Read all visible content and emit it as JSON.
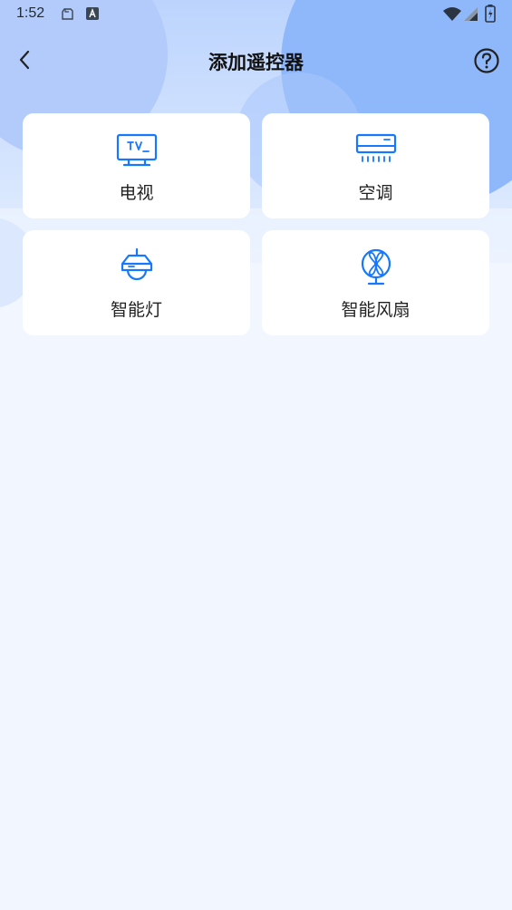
{
  "status_bar": {
    "time": "1:52"
  },
  "header": {
    "title": "添加遥控器"
  },
  "devices": [
    {
      "label": "电视",
      "icon": "tv-icon"
    },
    {
      "label": "空调",
      "icon": "air-conditioner-icon"
    },
    {
      "label": "智能灯",
      "icon": "ceiling-lamp-icon"
    },
    {
      "label": "智能风扇",
      "icon": "fan-icon"
    }
  ],
  "colors": {
    "accent": "#1677ff",
    "background": "#f2f7ff",
    "card": "#ffffff",
    "decor_blue": "#8fb8fb"
  }
}
